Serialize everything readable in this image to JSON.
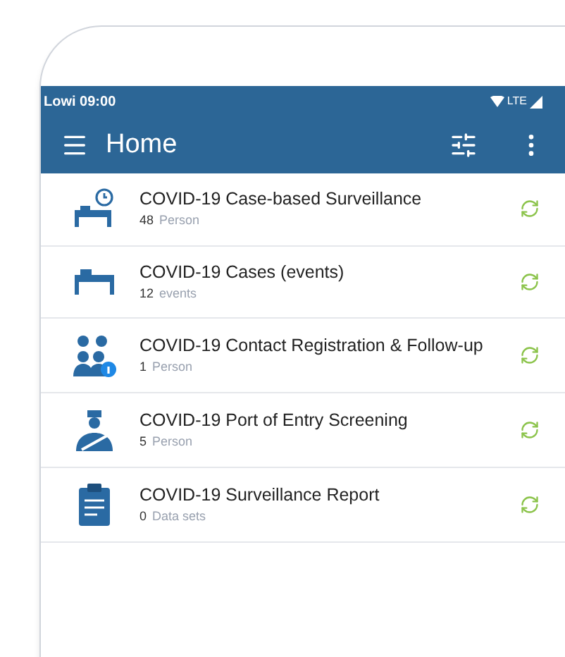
{
  "status_bar": {
    "carrier": "Lowi 09:00",
    "network": "LTE"
  },
  "toolbar": {
    "title": "Home"
  },
  "programs": [
    {
      "kind": "bed-clock",
      "title": "COVID-19 Case-based Surveillance",
      "count": "48",
      "unit": "Person"
    },
    {
      "kind": "bed",
      "title": "COVID-19 Cases (events)",
      "count": "12",
      "unit": "events"
    },
    {
      "kind": "people",
      "title": "COVID-19 Contact Registration & Follow-up",
      "count": "1",
      "unit": "Person"
    },
    {
      "kind": "person",
      "title": "COVID-19 Port of Entry Screening",
      "count": "5",
      "unit": "Person"
    },
    {
      "kind": "clipboard",
      "title": "COVID-19 Surveillance Report",
      "count": "0",
      "unit": "Data sets"
    }
  ]
}
